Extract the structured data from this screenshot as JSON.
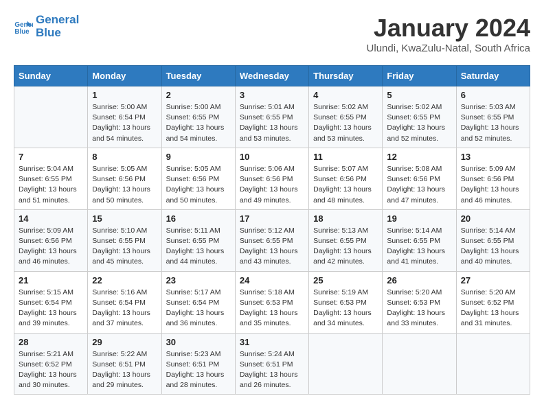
{
  "header": {
    "logo_line1": "General",
    "logo_line2": "Blue",
    "month_year": "January 2024",
    "location": "Ulundi, KwaZulu-Natal, South Africa"
  },
  "columns": [
    "Sunday",
    "Monday",
    "Tuesday",
    "Wednesday",
    "Thursday",
    "Friday",
    "Saturday"
  ],
  "weeks": [
    [
      {
        "day": "",
        "text": ""
      },
      {
        "day": "1",
        "text": "Sunrise: 5:00 AM\nSunset: 6:54 PM\nDaylight: 13 hours\nand 54 minutes."
      },
      {
        "day": "2",
        "text": "Sunrise: 5:00 AM\nSunset: 6:55 PM\nDaylight: 13 hours\nand 54 minutes."
      },
      {
        "day": "3",
        "text": "Sunrise: 5:01 AM\nSunset: 6:55 PM\nDaylight: 13 hours\nand 53 minutes."
      },
      {
        "day": "4",
        "text": "Sunrise: 5:02 AM\nSunset: 6:55 PM\nDaylight: 13 hours\nand 53 minutes."
      },
      {
        "day": "5",
        "text": "Sunrise: 5:02 AM\nSunset: 6:55 PM\nDaylight: 13 hours\nand 52 minutes."
      },
      {
        "day": "6",
        "text": "Sunrise: 5:03 AM\nSunset: 6:55 PM\nDaylight: 13 hours\nand 52 minutes."
      }
    ],
    [
      {
        "day": "7",
        "text": "Sunrise: 5:04 AM\nSunset: 6:55 PM\nDaylight: 13 hours\nand 51 minutes."
      },
      {
        "day": "8",
        "text": "Sunrise: 5:05 AM\nSunset: 6:56 PM\nDaylight: 13 hours\nand 50 minutes."
      },
      {
        "day": "9",
        "text": "Sunrise: 5:05 AM\nSunset: 6:56 PM\nDaylight: 13 hours\nand 50 minutes."
      },
      {
        "day": "10",
        "text": "Sunrise: 5:06 AM\nSunset: 6:56 PM\nDaylight: 13 hours\nand 49 minutes."
      },
      {
        "day": "11",
        "text": "Sunrise: 5:07 AM\nSunset: 6:56 PM\nDaylight: 13 hours\nand 48 minutes."
      },
      {
        "day": "12",
        "text": "Sunrise: 5:08 AM\nSunset: 6:56 PM\nDaylight: 13 hours\nand 47 minutes."
      },
      {
        "day": "13",
        "text": "Sunrise: 5:09 AM\nSunset: 6:56 PM\nDaylight: 13 hours\nand 46 minutes."
      }
    ],
    [
      {
        "day": "14",
        "text": "Sunrise: 5:09 AM\nSunset: 6:56 PM\nDaylight: 13 hours\nand 46 minutes."
      },
      {
        "day": "15",
        "text": "Sunrise: 5:10 AM\nSunset: 6:55 PM\nDaylight: 13 hours\nand 45 minutes."
      },
      {
        "day": "16",
        "text": "Sunrise: 5:11 AM\nSunset: 6:55 PM\nDaylight: 13 hours\nand 44 minutes."
      },
      {
        "day": "17",
        "text": "Sunrise: 5:12 AM\nSunset: 6:55 PM\nDaylight: 13 hours\nand 43 minutes."
      },
      {
        "day": "18",
        "text": "Sunrise: 5:13 AM\nSunset: 6:55 PM\nDaylight: 13 hours\nand 42 minutes."
      },
      {
        "day": "19",
        "text": "Sunrise: 5:14 AM\nSunset: 6:55 PM\nDaylight: 13 hours\nand 41 minutes."
      },
      {
        "day": "20",
        "text": "Sunrise: 5:14 AM\nSunset: 6:55 PM\nDaylight: 13 hours\nand 40 minutes."
      }
    ],
    [
      {
        "day": "21",
        "text": "Sunrise: 5:15 AM\nSunset: 6:54 PM\nDaylight: 13 hours\nand 39 minutes."
      },
      {
        "day": "22",
        "text": "Sunrise: 5:16 AM\nSunset: 6:54 PM\nDaylight: 13 hours\nand 37 minutes."
      },
      {
        "day": "23",
        "text": "Sunrise: 5:17 AM\nSunset: 6:54 PM\nDaylight: 13 hours\nand 36 minutes."
      },
      {
        "day": "24",
        "text": "Sunrise: 5:18 AM\nSunset: 6:53 PM\nDaylight: 13 hours\nand 35 minutes."
      },
      {
        "day": "25",
        "text": "Sunrise: 5:19 AM\nSunset: 6:53 PM\nDaylight: 13 hours\nand 34 minutes."
      },
      {
        "day": "26",
        "text": "Sunrise: 5:20 AM\nSunset: 6:53 PM\nDaylight: 13 hours\nand 33 minutes."
      },
      {
        "day": "27",
        "text": "Sunrise: 5:20 AM\nSunset: 6:52 PM\nDaylight: 13 hours\nand 31 minutes."
      }
    ],
    [
      {
        "day": "28",
        "text": "Sunrise: 5:21 AM\nSunset: 6:52 PM\nDaylight: 13 hours\nand 30 minutes."
      },
      {
        "day": "29",
        "text": "Sunrise: 5:22 AM\nSunset: 6:51 PM\nDaylight: 13 hours\nand 29 minutes."
      },
      {
        "day": "30",
        "text": "Sunrise: 5:23 AM\nSunset: 6:51 PM\nDaylight: 13 hours\nand 28 minutes."
      },
      {
        "day": "31",
        "text": "Sunrise: 5:24 AM\nSunset: 6:51 PM\nDaylight: 13 hours\nand 26 minutes."
      },
      {
        "day": "",
        "text": ""
      },
      {
        "day": "",
        "text": ""
      },
      {
        "day": "",
        "text": ""
      }
    ]
  ]
}
